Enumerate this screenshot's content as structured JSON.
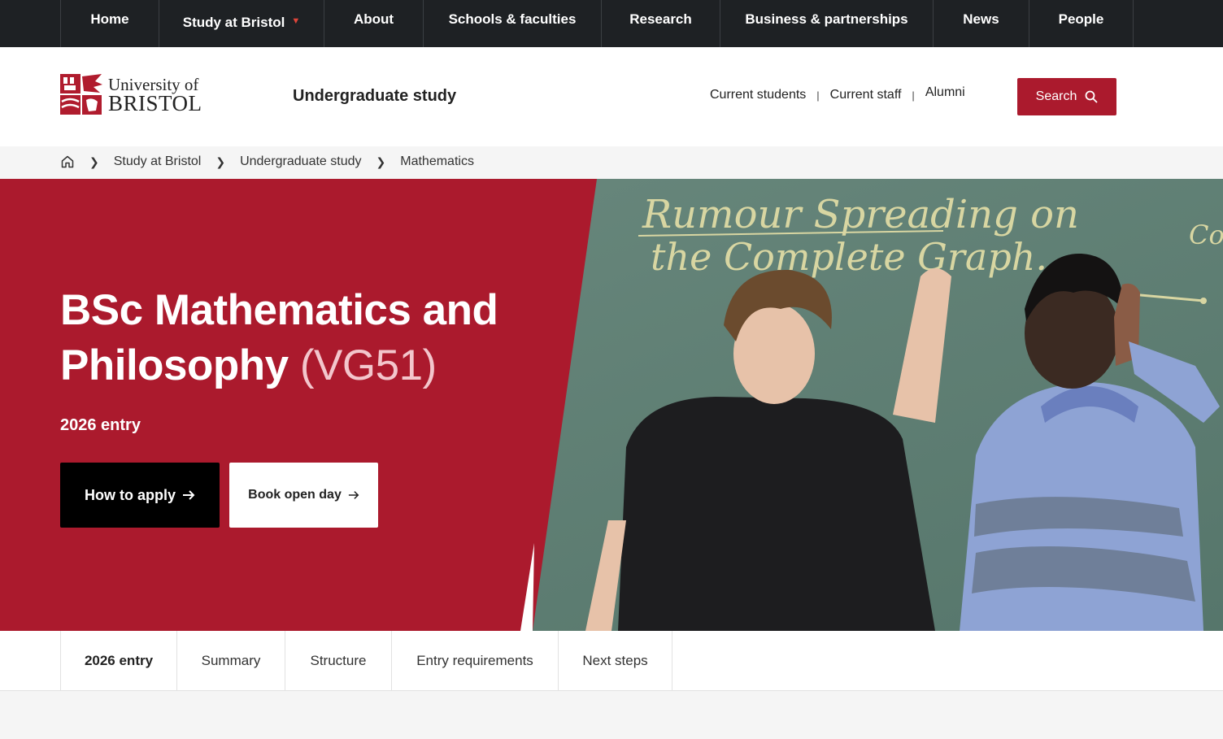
{
  "topnav": {
    "items": [
      {
        "label": "Home"
      },
      {
        "label": "Study at Bristol"
      },
      {
        "label": "About"
      },
      {
        "label": "Schools & faculties"
      },
      {
        "label": "Research"
      },
      {
        "label": "Business & partnerships"
      },
      {
        "label": "News"
      },
      {
        "label": "People"
      }
    ]
  },
  "header": {
    "logo_line1": "University of",
    "logo_line2": "BRISTOL",
    "site_title": "Undergraduate study",
    "util_links": [
      "Current students",
      "Current staff",
      "Alumni"
    ],
    "search_label": "Search"
  },
  "breadcrumb": {
    "items": [
      "Study at Bristol",
      "Undergraduate study",
      "Mathematics"
    ]
  },
  "hero": {
    "title": "BSc Mathematics and Philosophy",
    "course_code": "(VG51)",
    "entry": "2026 entry",
    "apply_label": "How to apply",
    "open_day_label": "Book open day",
    "photo_board_text_line1": "Rumour Spreading on",
    "photo_board_text_line2": "the Complete Graph.",
    "photo_board_text_side": "Com"
  },
  "tabs": {
    "items": [
      "2026 entry",
      "Summary",
      "Structure",
      "Entry requirements",
      "Next steps"
    ],
    "active": "2026 entry"
  },
  "colors": {
    "brand_red": "#ab1a2d",
    "nav_bg": "#1e2124",
    "chalkboard": "#5f7f72"
  }
}
